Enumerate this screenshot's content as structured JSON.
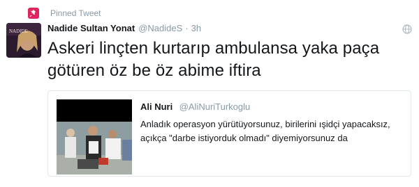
{
  "pinned": {
    "label": "Pinned Tweet",
    "icon": "pin-icon",
    "color": "#e0245e"
  },
  "tweet": {
    "fullname": "Nadide Sultan Yonat",
    "username": "@NadideS",
    "separator": "·",
    "time": "3h",
    "text": "Askeri linçten kurtarıp ambulansa yaka paça götüren öz be öz abime iftira",
    "globe_icon": "globe-icon"
  },
  "quote": {
    "fullname": "Ali Nuri",
    "username": "@AliNuriTurkoglu",
    "text": "Anladık operasyon yürütüyorsunuz, birilerini ışidçi yapacaksız, açıkça \"darbe istiyorduk olmadı\" diyemiyorsunuz da"
  },
  "colors": {
    "text": "#14171a",
    "secondary": "#8899a6",
    "border": "#e1e8ed"
  }
}
